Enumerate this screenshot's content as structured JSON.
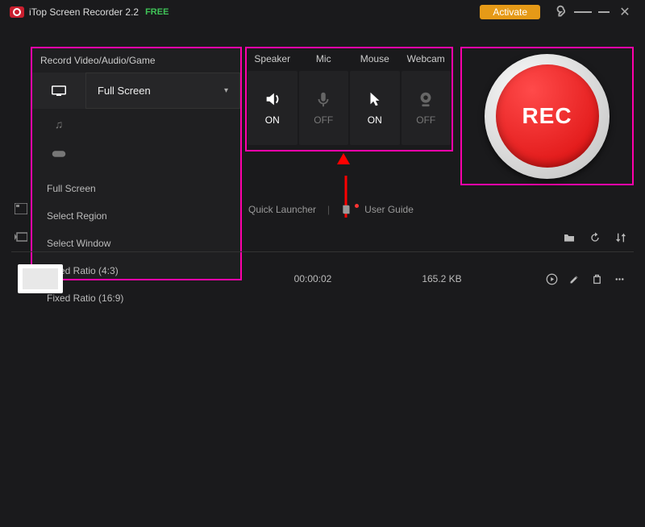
{
  "titlebar": {
    "app_name": "iTop Screen Recorder 2.2",
    "free_tag": "FREE",
    "activate_label": "Activate"
  },
  "record_panel": {
    "title": "Record Video/Audio/Game",
    "mode_selected": "Full Screen",
    "options": [
      "Full Screen",
      "Select Region",
      "Select Window",
      "Fixed Ratio (4:3)",
      "Fixed Ratio (16:9)"
    ]
  },
  "devices": {
    "speaker": {
      "label": "Speaker",
      "state": "ON"
    },
    "mic": {
      "label": "Mic",
      "state": "OFF"
    },
    "mouse": {
      "label": "Mouse",
      "state": "ON"
    },
    "webcam": {
      "label": "Webcam",
      "state": "OFF"
    }
  },
  "rec_button": {
    "label": "REC"
  },
  "quick_row": {
    "quick_launcher": "Quick Launcher",
    "user_guide": "User Guide"
  },
  "recording_row": {
    "duration": "00:00:02",
    "size": "165.2 KB"
  },
  "colors": {
    "highlight": "#ff00aa",
    "activate": "#e69a17",
    "rec_red": "#d80a0a",
    "free_green": "#3fc357"
  }
}
